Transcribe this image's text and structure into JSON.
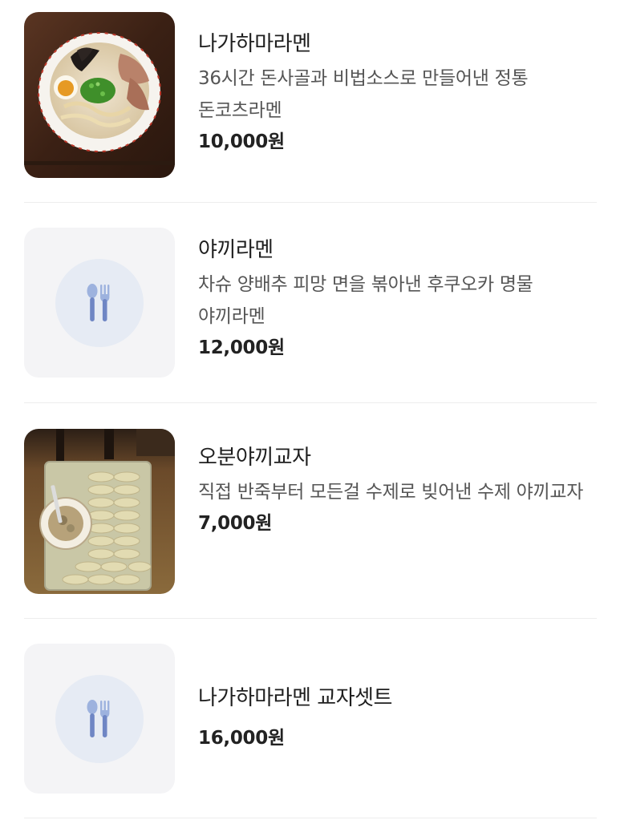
{
  "menu": {
    "items": [
      {
        "name": "나가하마라멘",
        "description": "36시간 돈사골과 비법소스로 만들어낸 정통 돈코츠라멘",
        "price": "10,000원",
        "image": "photo-tonkotsu-ramen-bowl"
      },
      {
        "name": "야끼라멘",
        "description": "차슈 양배추 피망 면을 볶아낸 후쿠오카 명물 야끼라멘",
        "price": "12,000원",
        "image": "spoon-fork-icon"
      },
      {
        "name": "오분야끼교자",
        "description": "직접 반죽부터 모든걸 수제로 빚어낸 수제 야끼교자",
        "price": "7,000원",
        "image": "photo-gyoza-tray"
      },
      {
        "name": "나가하마라멘 교자셋트",
        "description": "",
        "price": "16,000원",
        "image": "spoon-fork-icon"
      }
    ]
  }
}
